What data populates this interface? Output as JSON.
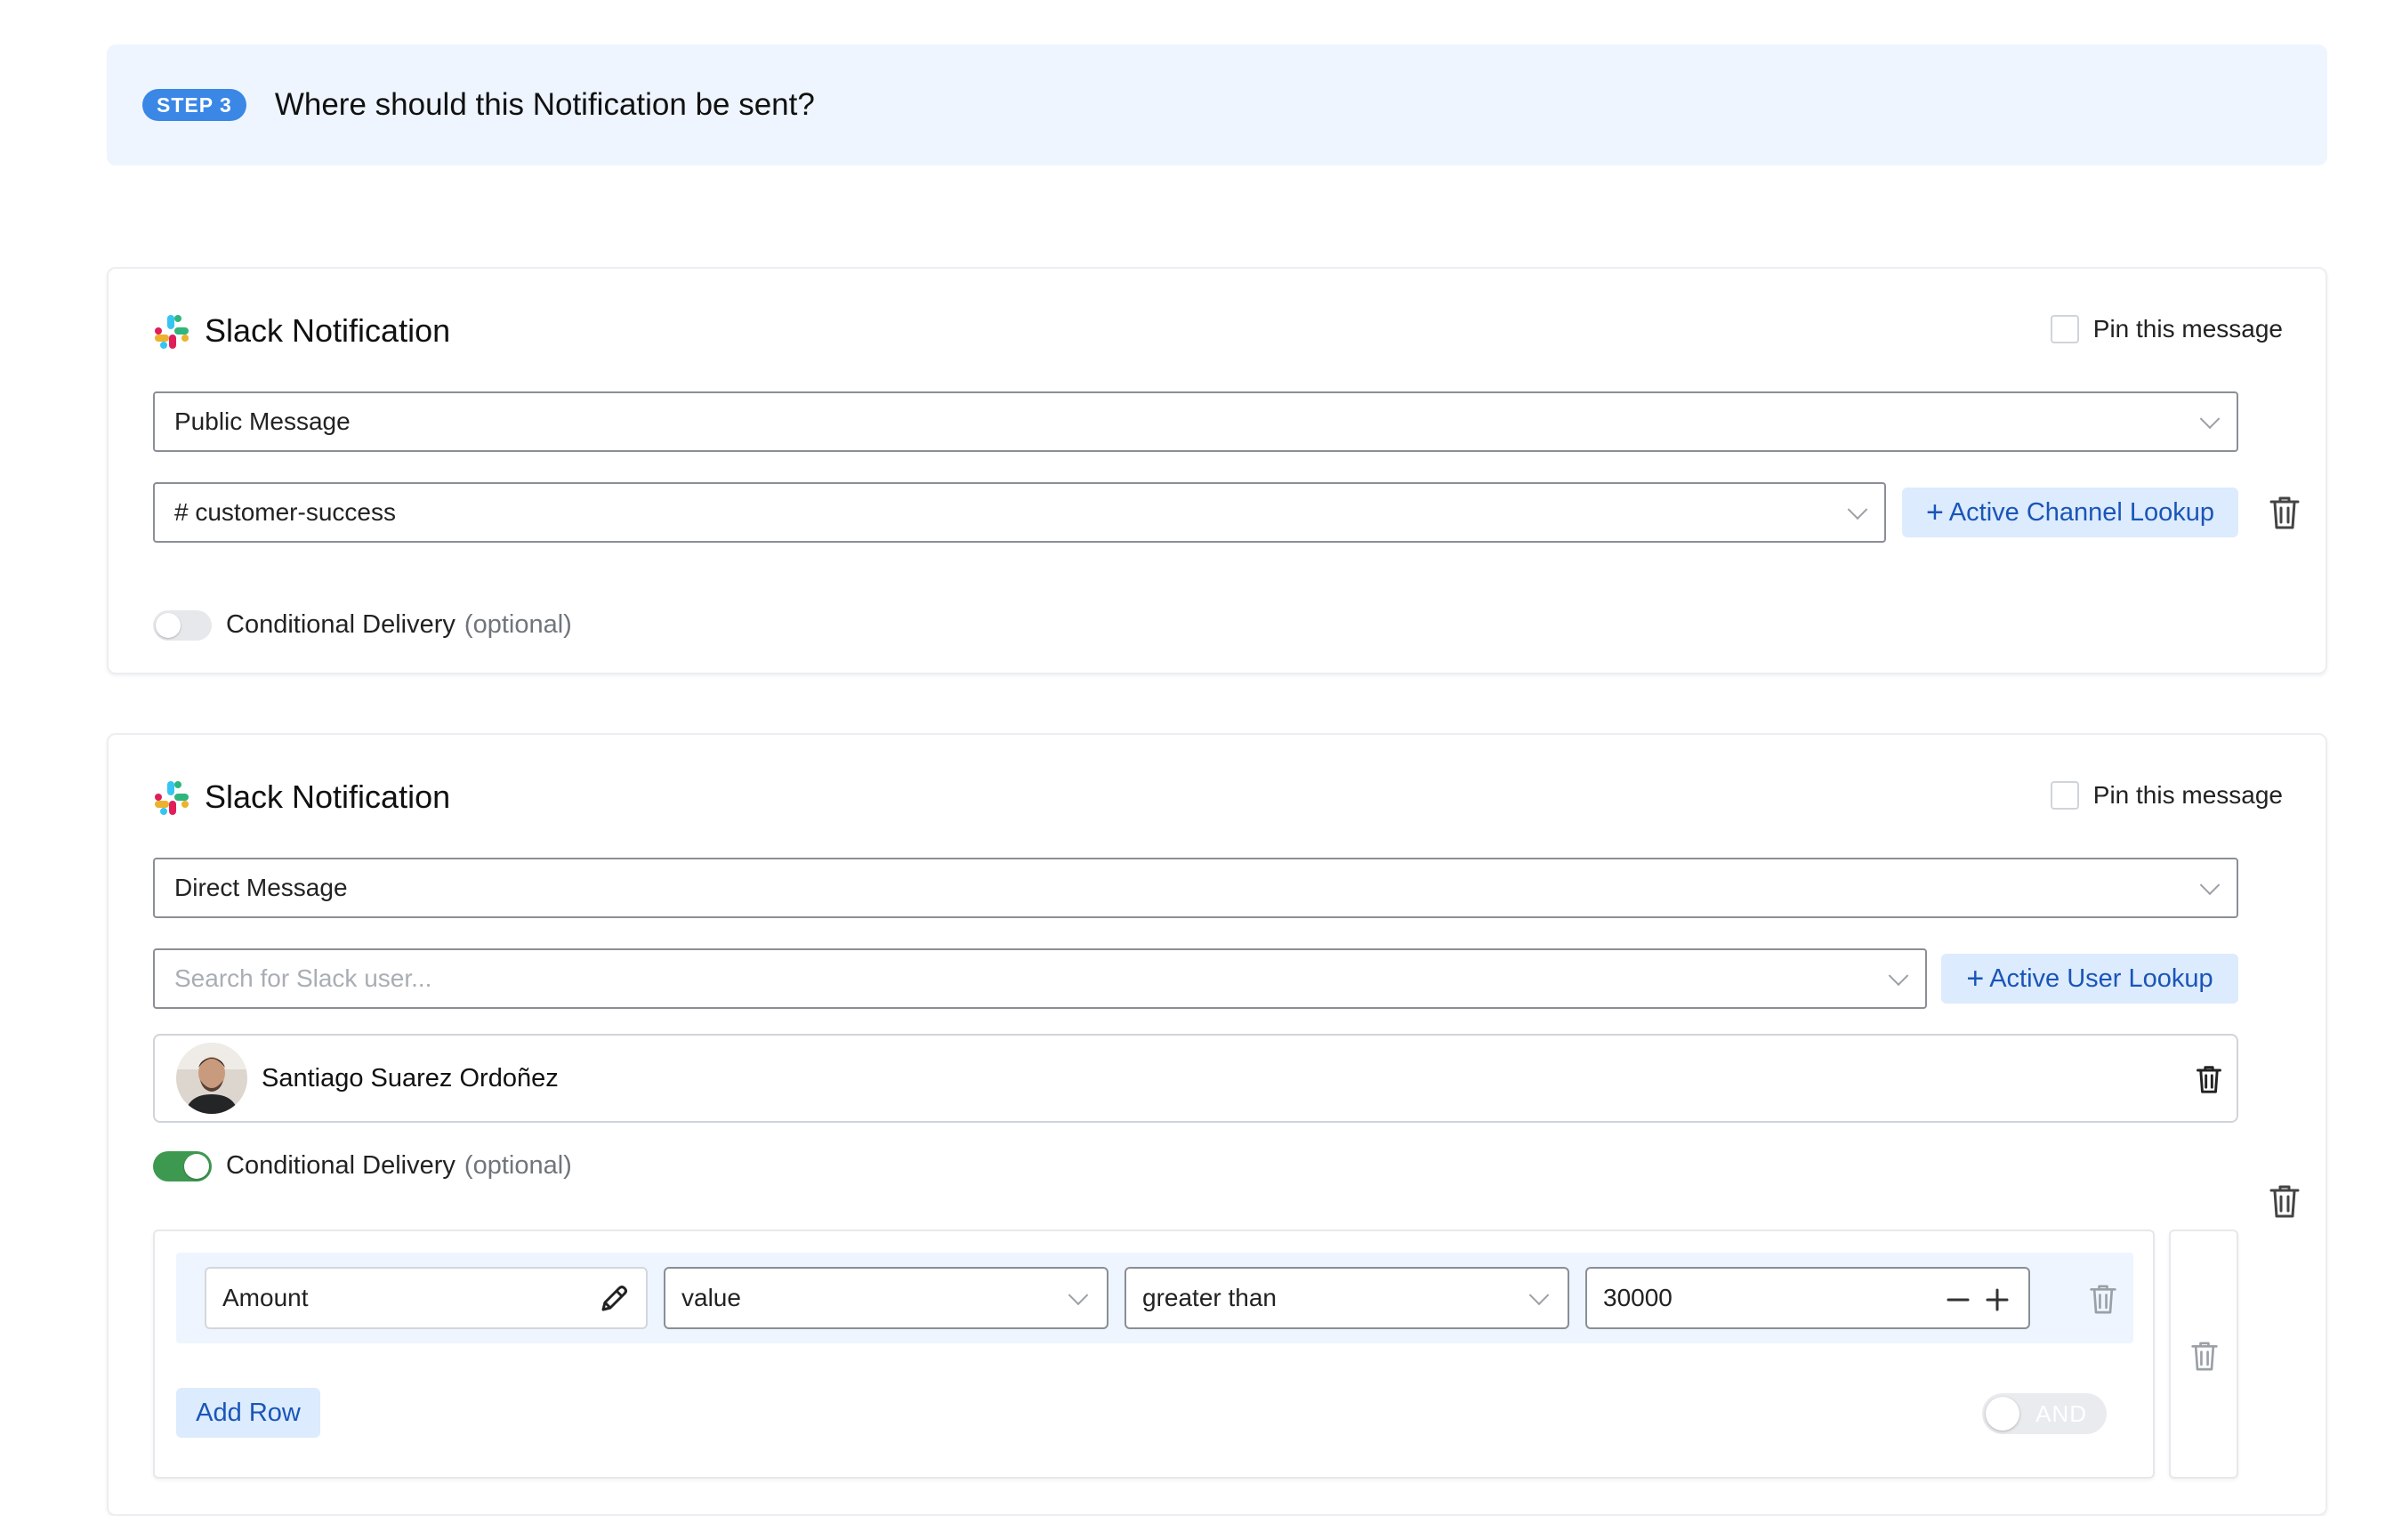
{
  "step": {
    "badge": "STEP 3",
    "title": "Where should this Notification be sent?"
  },
  "cards": [
    {
      "title": "Slack Notification",
      "pin_label": "Pin this message",
      "message_type": "Public Message",
      "channel": "# customer-success",
      "lookup_button": "Active Channel Lookup",
      "conditional_label": "Conditional Delivery",
      "conditional_optional": "(optional)",
      "conditional_enabled": false
    },
    {
      "title": "Slack Notification",
      "pin_label": "Pin this message",
      "message_type": "Direct Message",
      "user_search_placeholder": "Search for Slack user...",
      "lookup_button": "Active User Lookup",
      "selected_user": "Santiago Suarez Ordoñez",
      "conditional_label": "Conditional Delivery",
      "conditional_optional": "(optional)",
      "conditional_enabled": true,
      "condition": {
        "field": "Amount",
        "attribute": "value",
        "operator": "greater than",
        "value": "30000",
        "add_row": "Add Row",
        "join": "AND"
      }
    }
  ],
  "icons": {
    "brand": "slack-logo-icon",
    "delete": "trash-icon",
    "edit": "pencil-icon",
    "dropdown": "chevron-down-icon"
  },
  "colors": {
    "accent": "#3a87e6",
    "toggle_on": "#3e9950",
    "lookup_bg": "#dcebfd",
    "banner_bg": "#eef5fe"
  }
}
